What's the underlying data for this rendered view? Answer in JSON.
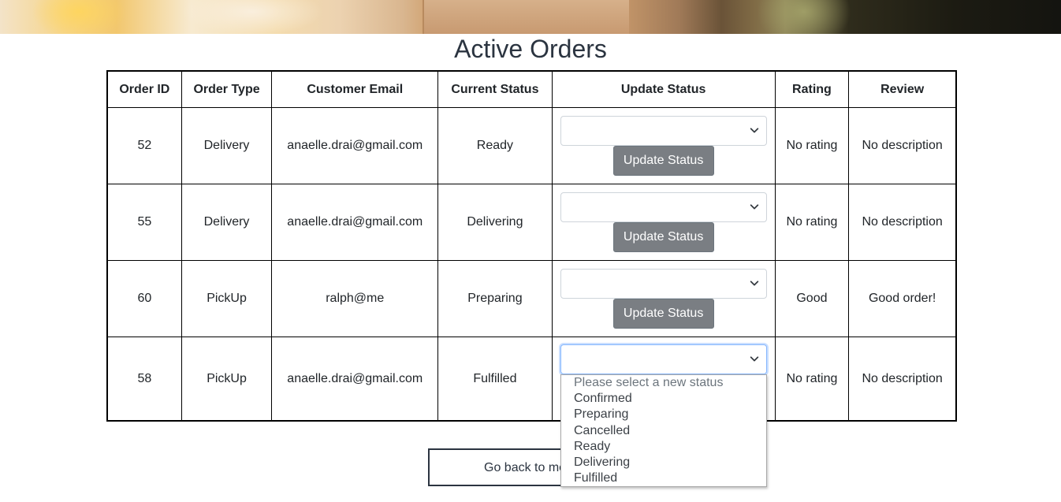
{
  "page": {
    "title": "Active Orders"
  },
  "table": {
    "headers": {
      "order_id": "Order ID",
      "order_type": "Order Type",
      "customer_email": "Customer Email",
      "current_status": "Current Status",
      "update_status": "Update Status",
      "rating": "Rating",
      "review": "Review"
    },
    "rows": [
      {
        "order_id": "52",
        "order_type": "Delivery",
        "customer_email": "anaelle.drai@gmail.com",
        "current_status": "Ready",
        "update_button": "Update Status",
        "rating": "No rating",
        "review": "No description"
      },
      {
        "order_id": "55",
        "order_type": "Delivery",
        "customer_email": "anaelle.drai@gmail.com",
        "current_status": "Delivering",
        "update_button": "Update Status",
        "rating": "No rating",
        "review": "No description"
      },
      {
        "order_id": "60",
        "order_type": "PickUp",
        "customer_email": "ralph@me",
        "current_status": "Preparing",
        "update_button": "Update Status",
        "rating": "Good",
        "review": "Good order!"
      },
      {
        "order_id": "58",
        "order_type": "PickUp",
        "customer_email": "anaelle.drai@gmail.com",
        "current_status": "Fulfilled",
        "rating": "No rating",
        "review": "No description"
      }
    ]
  },
  "status_dropdown": {
    "placeholder": "Please select a new status",
    "options": [
      "Confirmed",
      "Preparing",
      "Cancelled",
      "Ready",
      "Delivering",
      "Fulfilled"
    ]
  },
  "footer": {
    "back_button_label": "Go back to me"
  },
  "icons": {
    "select_chevron": "chevron-down-icon"
  }
}
